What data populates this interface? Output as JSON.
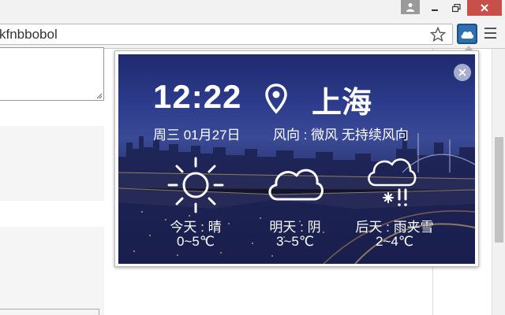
{
  "browser": {
    "url_text": "kfnbbobol"
  },
  "weather": {
    "time": "12:22",
    "city": "上海",
    "date": "周三 01月27日",
    "wind": "风向 : 微风 无持续风向",
    "forecast": [
      {
        "label": "今天 : 晴",
        "temp": "0~5℃",
        "icon": "sun-icon"
      },
      {
        "label": "明天 : 阴",
        "temp": "3~5℃",
        "icon": "cloud-icon"
      },
      {
        "label": "后天 : 雨夹雪",
        "temp": "2~4℃",
        "icon": "sleet-icon"
      }
    ]
  },
  "colors": {
    "close_button": "#c7504a",
    "extension_button": "#2f6fb0",
    "panel_top": "#1f2a6e",
    "panel_bottom": "#121536"
  }
}
